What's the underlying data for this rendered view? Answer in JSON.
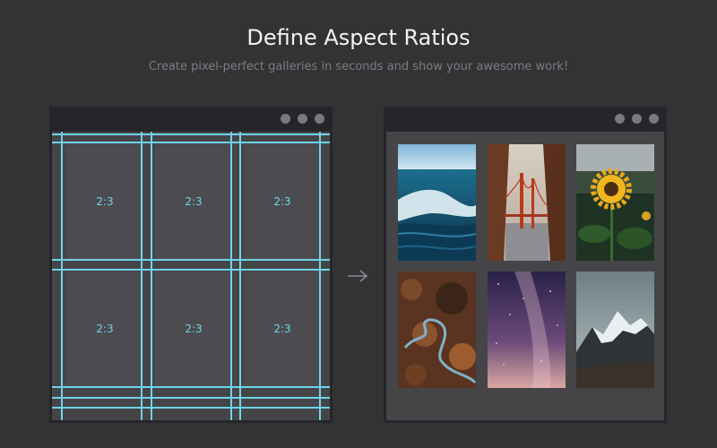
{
  "header": {
    "title": "Define Aspect Ratios",
    "subtitle": "Create pixel-perfect galleries in seconds and show your awesome work!"
  },
  "left_window": {
    "cells": [
      {
        "ratio": "2:3"
      },
      {
        "ratio": "2:3"
      },
      {
        "ratio": "2:3"
      },
      {
        "ratio": "2:3"
      },
      {
        "ratio": "2:3"
      },
      {
        "ratio": "2:3"
      }
    ]
  },
  "right_window": {
    "photos": [
      "ocean-wave",
      "golden-gate-bridge",
      "sunflower",
      "winding-river-aerial",
      "milky-way-sky",
      "snowy-mountain"
    ]
  },
  "icons": {
    "arrow": "arrow-right-icon",
    "window_controls": "circle-dot-icon"
  },
  "colors": {
    "background": "#333336",
    "window": "#26262a",
    "canvas": "#454548",
    "guide": "#6fd3ea"
  }
}
